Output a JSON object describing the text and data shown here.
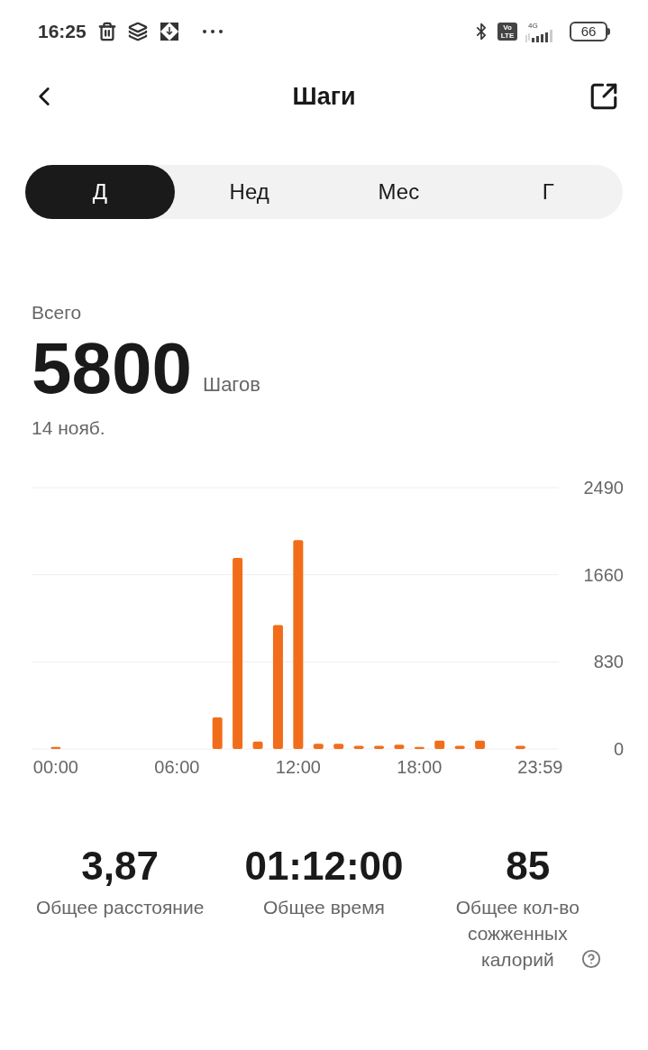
{
  "status_bar": {
    "time": "16:25",
    "volte": "Vo LTE",
    "network": "4G",
    "battery": "66"
  },
  "header": {
    "title": "Шаги"
  },
  "tabs": [
    {
      "label": "Д",
      "selected": true
    },
    {
      "label": "Нед",
      "selected": false
    },
    {
      "label": "Мес",
      "selected": false
    },
    {
      "label": "Г",
      "selected": false
    }
  ],
  "summary": {
    "label": "Всего",
    "value": "5800",
    "unit": "Шагов",
    "date": "14 нояб."
  },
  "chart_data": {
    "type": "bar",
    "x": [
      0,
      1,
      2,
      3,
      4,
      5,
      6,
      7,
      8,
      9,
      10,
      11,
      12,
      13,
      14,
      15,
      16,
      17,
      18,
      19,
      20,
      21,
      22,
      23
    ],
    "series": [
      {
        "color": "#f26d1a",
        "values": [
          20,
          0,
          0,
          0,
          0,
          0,
          0,
          0,
          300,
          1820,
          70,
          1180,
          1990,
          50,
          50,
          30,
          30,
          40,
          20,
          80,
          30,
          80,
          0,
          30
        ]
      }
    ],
    "xlim": [
      -1.2,
      24.9
    ],
    "ylim": [
      0,
      2490
    ],
    "yticks": [
      0,
      830,
      1660,
      2490
    ],
    "xticks": [
      {
        "value": 0,
        "label": "00:00"
      },
      {
        "value": 6,
        "label": "06:00"
      },
      {
        "value": 12,
        "label": "12:00"
      },
      {
        "value": 18,
        "label": "18:00"
      },
      {
        "value": 23.98,
        "label": "23:59"
      }
    ]
  },
  "stats": [
    {
      "value": "3,87",
      "label": "Общее расстояние",
      "info": false
    },
    {
      "value": "01:12:00",
      "label": "Общее время",
      "info": false
    },
    {
      "value": "85",
      "label": "Общее кол-во сожженных калорий",
      "info": true
    }
  ]
}
